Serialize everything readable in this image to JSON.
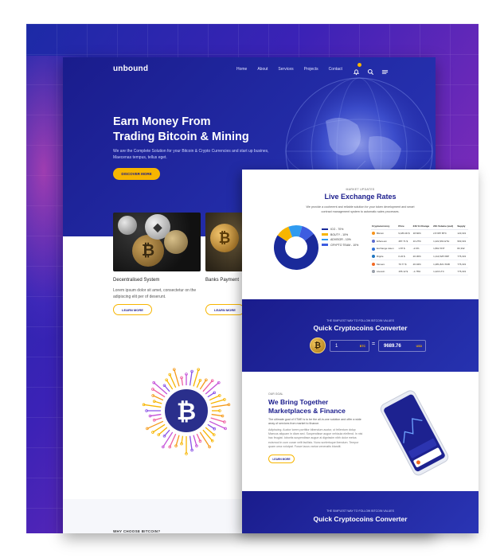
{
  "brand": {
    "logo": "unbound"
  },
  "nav": {
    "items": [
      "Home",
      "About",
      "Services",
      "Projects",
      "Contact"
    ]
  },
  "hero": {
    "title_line1": "Earn Money From",
    "title_line2": "Trading Bitcoin & Mining",
    "subtitle": "We are the Complete Solution for your Bitcoin & Crypto Currencies and start up busines, Maecenas tempus, tellus eget.",
    "cta": "DISCOVER MORE"
  },
  "features": [
    {
      "title": "Decentralised System",
      "text": "Lorem ipsum dolor sit amet, consectetur on the adipiscing elit per of deserunt.",
      "cta": "LEARN MORE"
    },
    {
      "title": "Banks Payment",
      "cta": "LEARN MORE"
    }
  ],
  "why": {
    "label": "WHY CHOOSE BITCOIN?"
  },
  "rates": {
    "kicker": "MARKET UPDATES",
    "title": "Live Exchange Rates",
    "desc": "We provide a cooherent and reliable solution for your token development and smart contract management system to automatic sales processes.",
    "legend": [
      {
        "label": "ICO - 70%",
        "color": "#1a2a9a"
      },
      {
        "label": "BOUTY - 10%",
        "color": "#f7b500"
      },
      {
        "label": "ADVISOR - 10%",
        "color": "#2f9bf0"
      },
      {
        "label": "CRYPTO TEAM - 10%",
        "color": "#3d5ce0"
      }
    ],
    "columns": [
      "Cryptocurrency",
      "Price",
      "24h % Change",
      "24h Volume (usd)",
      "Supply"
    ],
    "rows": [
      {
        "name": "Bitcoin",
        "price": "9,189.30 $",
        "change": "18.60%",
        "volume": "2.8 687 BTC",
        "supply": "123,331",
        "color": "#f7931a"
      },
      {
        "name": "Ethereum",
        "price": "487.71 $",
        "change": "10.27%",
        "volume": "1,222,361 ETH",
        "supply": "963,331",
        "color": "#5b6bcf"
      },
      {
        "name": "Exchange token",
        "price": "1.87 $",
        "change": "-2.6%",
        "volume": "1,802 XNT",
        "supply": "82,332",
        "color": "#2f6fd6"
      },
      {
        "name": "Ripple",
        "price": "0.22 $",
        "change": "20.30%",
        "volume": "1,114,528 XRP",
        "supply": "776,331",
        "color": "#1e74c0"
      },
      {
        "name": "Monero",
        "price": "79.77 $",
        "change": "20.04%",
        "volume": "1,281,821 XMR",
        "supply": "776,331",
        "color": "#f26822"
      },
      {
        "name": "Litecoin",
        "price": "155.12 $",
        "change": "-1.78%",
        "volume": "1,223 LTC",
        "supply": "776,331",
        "color": "#9aa0aa"
      }
    ]
  },
  "converter": {
    "kicker": "THE SIMPLEST WAY TO FOLLOW BITCOIN VALUES",
    "title": "Quick Cryptocoins Converter",
    "amount": "1",
    "from": "BTC",
    "equals": "=",
    "result": "9689.76",
    "to": "USD"
  },
  "goal": {
    "kicker": "OUR GOAL",
    "title_line1": "We Bring Together",
    "title_line2": "Marketplaces & Finance",
    "para1": "The ultimate goal of XTME is to be the all-in-one solution and offer a wide array of services from market to finance.",
    "para2": "Adipiscing. Auctor lorem porttitor bibendum auctor, ut fellentum dolup Maecus aliquam in diam sed. Suspendisse augue vehicula eleifend. In nisi hac feugiat. Iobortis suspendisse augue ai dignissim nibh dolor metus euismod in cum curae velit facilisis. Nunc scelerisque ibendum. Tempor quam urna volutpat. Fusce lacus varius venenatis blandit.",
    "cta": "LEARN MORE"
  },
  "converter2": {
    "kicker": "THE SIMPLEST WAY TO FOLLOW BITCOIN VALUES",
    "title": "Quick Cryptocoins Converter"
  }
}
